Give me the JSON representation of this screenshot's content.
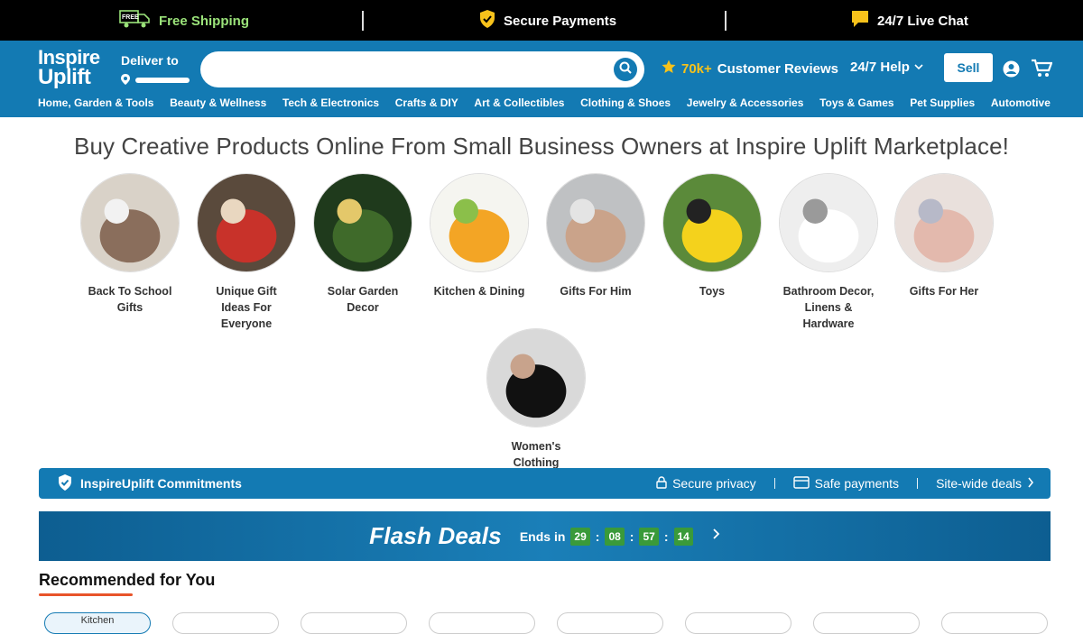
{
  "promo": {
    "free_shipping": "Free Shipping",
    "free_badge": "FREE",
    "secure_payments": "Secure Payments",
    "live_chat": "24/7 Live Chat"
  },
  "header": {
    "logo_line1": "Inspire",
    "logo_line2": "Uplift",
    "deliver_to": "Deliver to",
    "search_placeholder": "",
    "reviews_count": "70k+",
    "reviews_label": "Customer Reviews",
    "help": "24/7 Help",
    "sell": "Sell"
  },
  "categories": [
    "Home, Garden & Tools",
    "Beauty & Wellness",
    "Tech & Electronics",
    "Crafts & DIY",
    "Art & Collectibles",
    "Clothing & Shoes",
    "Jewelry & Accessories",
    "Toys & Games",
    "Pet Supplies",
    "Automotive"
  ],
  "headline": "Buy Creative Products Online From Small Business Owners at Inspire Uplift Marketplace!",
  "circles": [
    {
      "label": "Back To School Gifts"
    },
    {
      "label": "Unique Gift Ideas For Everyone"
    },
    {
      "label": "Solar Garden Decor"
    },
    {
      "label": "Kitchen & Dining"
    },
    {
      "label": "Gifts For Him"
    },
    {
      "label": "Toys"
    },
    {
      "label": "Bathroom Decor, Linens & Hardware"
    },
    {
      "label": "Gifts For Her"
    },
    {
      "label": "Women's Clothing"
    }
  ],
  "commitments": {
    "title": "InspireUplift Commitments",
    "privacy": "Secure privacy",
    "payments": "Safe payments",
    "deals": "Site-wide deals"
  },
  "flash": {
    "title": "Flash Deals",
    "ends_in": "Ends in",
    "hours": "29",
    "minutes": "08",
    "seconds": "57",
    "centis": "14"
  },
  "recommended": {
    "title": "Recommended for You",
    "chip_first": "Kitchen"
  },
  "colors": {
    "brand_blue": "#137ab3",
    "accent_orange": "#e8542a",
    "star_yellow": "#f7c21b",
    "timer_green": "#3a9a3a"
  }
}
